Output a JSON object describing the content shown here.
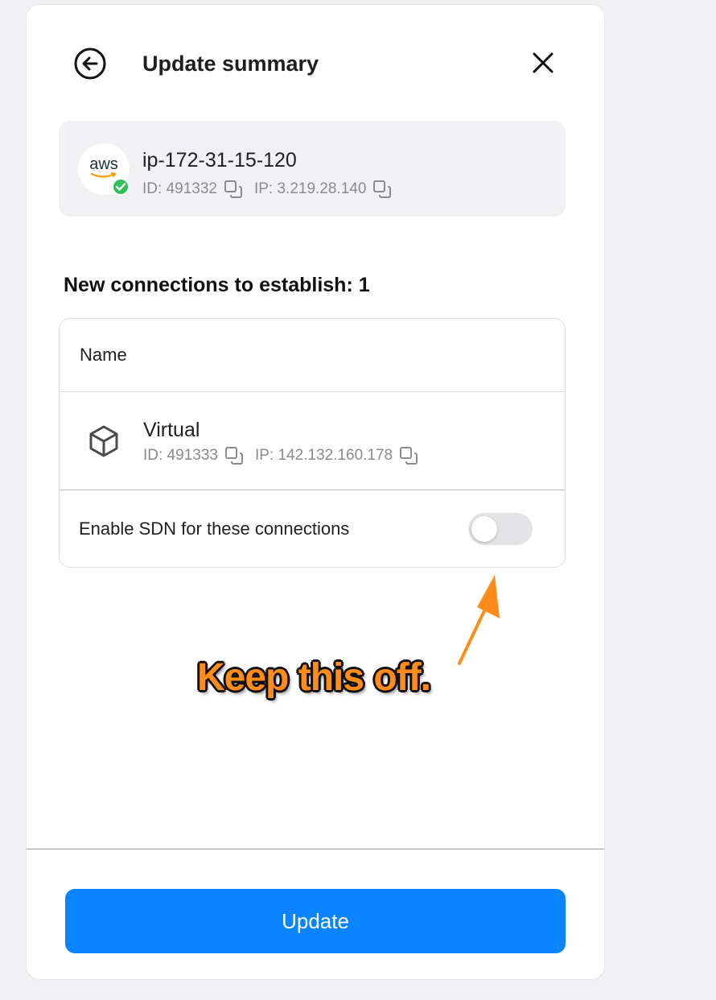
{
  "header": {
    "title": "Update summary",
    "back_icon": "back-arrow-circle-icon",
    "close_icon": "close-icon"
  },
  "server": {
    "logo_text": "aws",
    "name": "ip-172-31-15-120",
    "id_text": "ID: 491332",
    "ip_text": "IP: 3.219.28.140",
    "status": "connected"
  },
  "connections": {
    "heading": "New connections to establish: 1",
    "column_name": "Name",
    "rows": [
      {
        "name": "Virtual",
        "id_text": "ID: 491333",
        "ip_text": "IP: 142.132.160.178",
        "icon": "cube-icon"
      }
    ],
    "sdn_label": "Enable SDN for these connections",
    "sdn_enabled": false
  },
  "annotation": {
    "text": "Keep this off.",
    "color": "#ff8c1a"
  },
  "footer": {
    "update_label": "Update",
    "button_color": "#0a84ff"
  }
}
